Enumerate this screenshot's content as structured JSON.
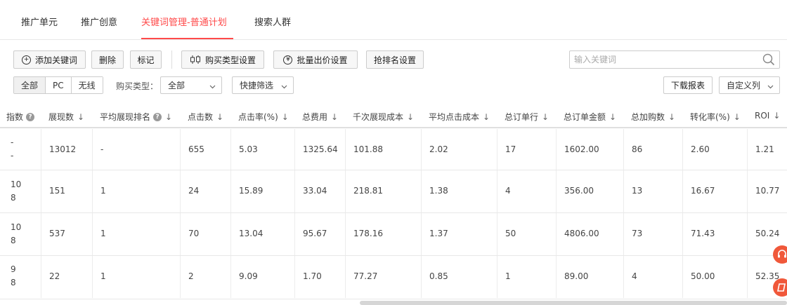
{
  "tabs": [
    "推广单元",
    "推广创意",
    "关键词管理-普通计划",
    "搜索人群"
  ],
  "toolbar": {
    "add_keyword": "添加关键词",
    "delete": "删除",
    "mark": "标记",
    "purchase_type_setting": "购买类型设置",
    "batch_bid_setting": "批量出价设置",
    "rank_grab_setting": "抢排名设置",
    "search_placeholder": "输入关键词"
  },
  "filters": {
    "device_tabs": [
      "全部",
      "PC",
      "无线"
    ],
    "purchase_type_label": "购买类型：",
    "purchase_type_value": "全部",
    "quick_filter": "快捷筛选",
    "download_report": "下载报表",
    "custom_columns": "自定义列"
  },
  "table": {
    "columns": [
      "指数",
      "展现数",
      "平均展现排名",
      "点击数",
      "点击率(%)",
      "总费用",
      "千次展现成本",
      "平均点击成本",
      "总订单行",
      "总订单金额",
      "总加购数",
      "转化率(%)",
      "ROI"
    ],
    "rows": [
      {
        "idx": [
          "-",
          "-"
        ],
        "cells": [
          "13012",
          "-",
          "655",
          "5.03",
          "1325.64",
          "101.88",
          "2.02",
          "17",
          "1602.00",
          "86",
          "2.60",
          "1.21"
        ]
      },
      {
        "idx": [
          "10",
          "8"
        ],
        "cells": [
          "151",
          "1",
          "24",
          "15.89",
          "33.04",
          "218.81",
          "1.38",
          "4",
          "356.00",
          "13",
          "16.67",
          "10.77"
        ]
      },
      {
        "idx": [
          "10",
          "8"
        ],
        "cells": [
          "537",
          "1",
          "70",
          "13.04",
          "95.67",
          "178.16",
          "1.37",
          "50",
          "4806.00",
          "73",
          "71.43",
          "50.24"
        ]
      },
      {
        "idx": [
          "9",
          "8"
        ],
        "cells": [
          "22",
          "1",
          "2",
          "9.09",
          "1.70",
          "77.27",
          "0.85",
          "1",
          "89.00",
          "4",
          "50.00",
          "52.35"
        ]
      }
    ]
  },
  "colors": {
    "accent": "#ff4a4a",
    "float": "#f0583a"
  }
}
